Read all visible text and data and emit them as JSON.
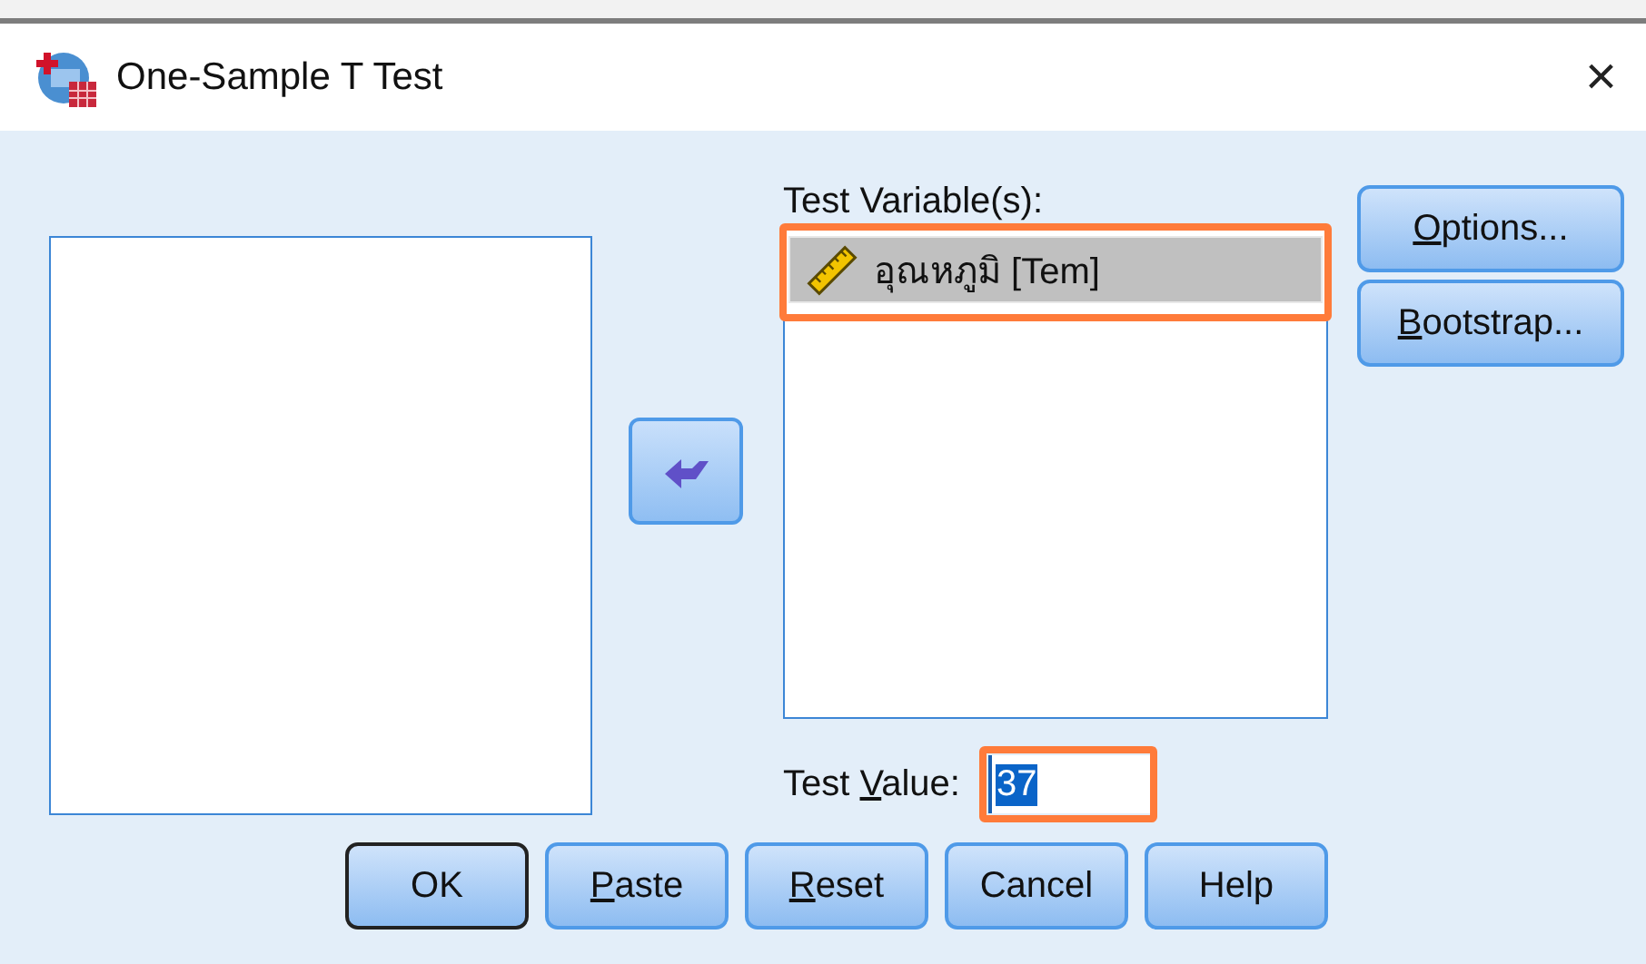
{
  "window": {
    "title": "One-Sample T Test",
    "close": "×"
  },
  "test_variables": {
    "label": "Test Variable(s):",
    "highlighted": true,
    "items": [
      {
        "text": "อุณหภูมิ [Tem]",
        "kind": "scale",
        "selected": true
      }
    ]
  },
  "test_value": {
    "label": {
      "before": "Test ",
      "key": "V",
      "after": "alue:"
    },
    "value": "37",
    "text_selected": true,
    "highlighted": true
  },
  "side_buttons": [
    {
      "label": {
        "key": "O",
        "after": "ptions..."
      }
    },
    {
      "label": {
        "key": "B",
        "after": "ootstrap..."
      }
    }
  ],
  "buttons": [
    {
      "label": {
        "after": "OK"
      },
      "default": true
    },
    {
      "label": {
        "key": "P",
        "after": "aste"
      },
      "default": false
    },
    {
      "label": {
        "key": "R",
        "after": "eset"
      },
      "default": false
    },
    {
      "label": {
        "after": "Cancel"
      },
      "default": false
    },
    {
      "label": {
        "after": "Help"
      },
      "default": false
    }
  ]
}
